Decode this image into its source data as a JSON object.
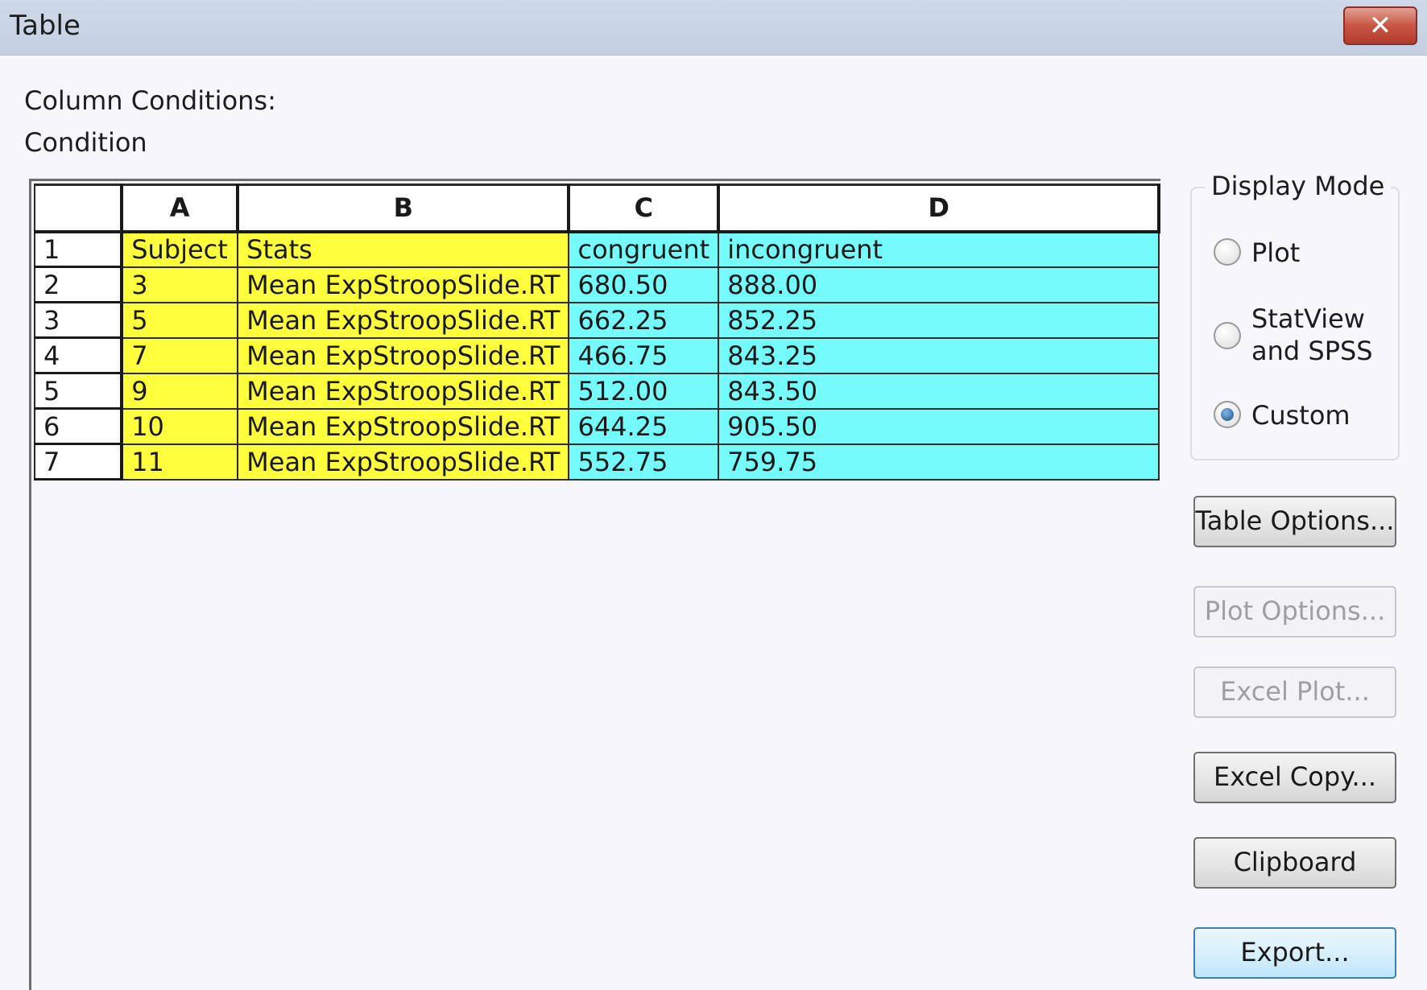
{
  "window": {
    "title": "Table",
    "close_icon_glyph": "✕"
  },
  "labels": {
    "column_conditions": "Column Conditions:",
    "condition": "Condition"
  },
  "grid": {
    "column_headers": [
      "",
      "A",
      "B",
      "C",
      "D"
    ],
    "rows": [
      {
        "num": "1",
        "cells": [
          "Subject",
          "Stats",
          "congruent",
          "incongruent"
        ]
      },
      {
        "num": "2",
        "cells": [
          "3",
          "Mean ExpStroopSlide.RT",
          "680.50",
          "888.00"
        ]
      },
      {
        "num": "3",
        "cells": [
          "5",
          "Mean ExpStroopSlide.RT",
          "662.25",
          "852.25"
        ]
      },
      {
        "num": "4",
        "cells": [
          "7",
          "Mean ExpStroopSlide.RT",
          "466.75",
          "843.25"
        ]
      },
      {
        "num": "5",
        "cells": [
          "9",
          "Mean ExpStroopSlide.RT",
          "512.00",
          "843.50"
        ]
      },
      {
        "num": "6",
        "cells": [
          "10",
          "Mean ExpStroopSlide.RT",
          "644.25",
          "905.50"
        ]
      },
      {
        "num": "7",
        "cells": [
          "11",
          "Mean ExpStroopSlide.RT",
          "552.75",
          "759.75"
        ]
      }
    ],
    "colors": {
      "yellow": "#ffff3e",
      "cyan": "#75fbfb"
    }
  },
  "display_mode": {
    "title": "Display Mode",
    "options": [
      "Plot",
      "StatView",
      "and SPSS",
      "Custom"
    ],
    "selected": "Custom"
  },
  "buttons": {
    "table_options": "Table Options...",
    "plot_options": "Plot Options...",
    "excel_plot": "Excel Plot...",
    "excel_copy": "Excel Copy...",
    "clipboard": "Clipboard",
    "export": "Export..."
  }
}
